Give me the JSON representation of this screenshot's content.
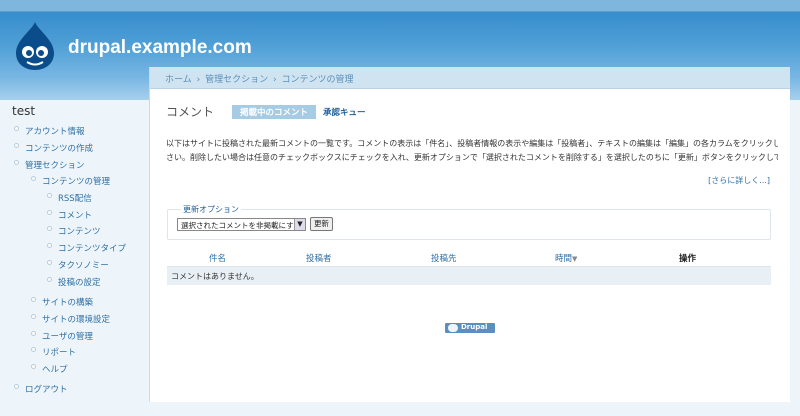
{
  "header": {
    "site_name": "drupal.example.com"
  },
  "breadcrumb": [
    "ホーム",
    "管理セクション",
    "コンテンツの管理"
  ],
  "breadcrumb_separator": "›",
  "page": {
    "title": "コメント",
    "tabs": [
      {
        "label": "掲載中のコメント",
        "active": true
      },
      {
        "label": "承認キュー",
        "active": false
      }
    ],
    "description_line1": "以下はサイトに投稿された最新コメントの一覧です。コメントの表示は「件名」、投稿者情報の表示や編集は「投稿者」、テキストの編集は「編集」の各カラムをクリックしてくださ",
    "description_line2": "さい。削除したい場合は任意のチェックボックスにチェックを入れ、更新オプションで「選択されたコメントを削除する」を選択したのちに「更新」ボタンをクリックしてください。",
    "more_link": "[さらに詳しく...]"
  },
  "update_options": {
    "legend": "更新オプション",
    "selected": "選択されたコメントを非掲載にする",
    "button": "更新"
  },
  "table": {
    "headers": [
      "件名",
      "投稿者",
      "投稿先",
      "時間",
      "操作"
    ],
    "sort_indicator": "▼",
    "empty_message": "コメントはありません。"
  },
  "footer": {
    "powered_by": "Drupal"
  },
  "sidebar": {
    "title": "test",
    "items": [
      {
        "label": "アカウント情報"
      },
      {
        "label": "コンテンツの作成"
      },
      {
        "label": "管理セクション"
      },
      {
        "label": "コンテンツの管理"
      },
      {
        "label": "RSS配信"
      },
      {
        "label": "コメント"
      },
      {
        "label": "コンテンツ"
      },
      {
        "label": "コンテンツタイプ"
      },
      {
        "label": "タクソノミー"
      },
      {
        "label": "投稿の設定"
      },
      {
        "label": "サイトの構築"
      },
      {
        "label": "サイトの環境設定"
      },
      {
        "label": "ユーザの管理"
      },
      {
        "label": "リポート"
      },
      {
        "label": "ヘルプ"
      },
      {
        "label": "ログアウト"
      }
    ]
  },
  "colors": {
    "header_blue": "#2d87c8",
    "link_blue": "#2f6fa6",
    "tab_active_bg": "#a6cbe4",
    "page_bg": "#edf5fa"
  }
}
